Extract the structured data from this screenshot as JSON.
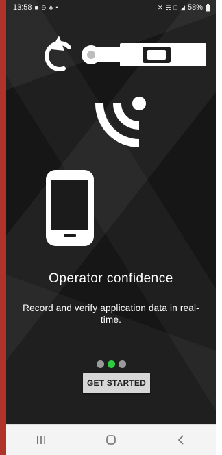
{
  "status_bar": {
    "time": "13:58",
    "left_icons": [
      "video-icon",
      "do-not-disturb-icon",
      "notification-icon",
      "dot-icon"
    ],
    "right_icons": [
      "mute-icon",
      "wifi-icon",
      "volte-icon",
      "signal-icon"
    ],
    "battery": "58%"
  },
  "onboarding": {
    "headline": "Operator confidence",
    "description": "Record and verify application data in real-time.",
    "pager": {
      "total": 3,
      "active_index": 1,
      "active_color": "#2ecc40",
      "inactive_color": "#9a9a9a"
    },
    "cta_label": "GET STARTED"
  },
  "nav_bar": {
    "buttons": [
      "recent-apps-button",
      "home-button",
      "back-button"
    ]
  }
}
